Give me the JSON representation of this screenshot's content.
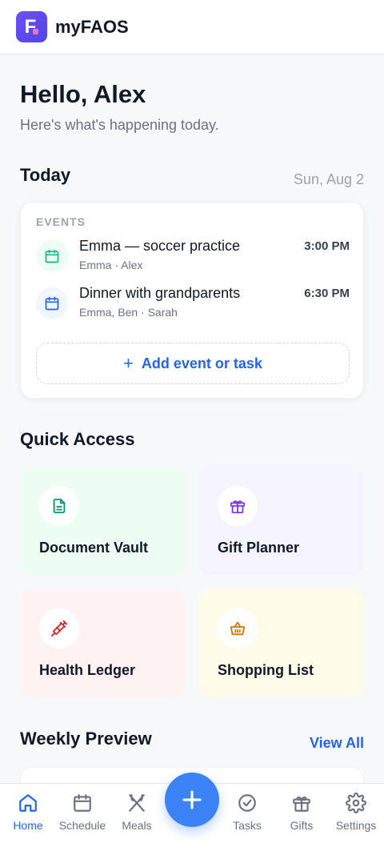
{
  "app": {
    "name": "myFAOS",
    "logo_letter": "F"
  },
  "greeting": {
    "title": "Hello, Alex",
    "subtitle": "Here's what's happening today."
  },
  "today": {
    "heading": "Today",
    "date": "Sun, Aug 2",
    "events_label": "EVENTS",
    "events": [
      {
        "title": "Emma — soccer practice",
        "people": "Emma · Alex",
        "time": "3:00 PM",
        "icon": "calendar-icon",
        "color": "#10b981"
      },
      {
        "title": "Dinner with grandparents",
        "people": "Emma, Ben · Sarah",
        "time": "6:30 PM",
        "icon": "calendar-icon",
        "color": "#2563eb"
      }
    ],
    "add_label": "Add event or task"
  },
  "quick_access": {
    "heading": "Quick Access",
    "tiles": [
      {
        "label": "Document Vault",
        "icon": "document-icon",
        "bg": "#ecfdf3",
        "color": "#059669"
      },
      {
        "label": "Gift Planner",
        "icon": "gift-icon",
        "bg": "#f5f3ff",
        "color": "#7c3aed"
      },
      {
        "label": "Health Ledger",
        "icon": "syringe-icon",
        "bg": "#fef2f2",
        "color": "#dc2626"
      },
      {
        "label": "Shopping List",
        "icon": "basket-icon",
        "bg": "#fefce8",
        "color": "#d97706"
      }
    ]
  },
  "weekly": {
    "heading": "Weekly Preview",
    "view_all": "View All"
  },
  "nav": {
    "items": [
      {
        "label": "Home",
        "icon": "home-icon",
        "active": true
      },
      {
        "label": "Schedule",
        "icon": "calendar-icon",
        "active": false
      },
      {
        "label": "Meals",
        "icon": "utensils-icon",
        "active": false
      },
      {
        "label": "Tasks",
        "icon": "check-circle-icon",
        "active": false
      },
      {
        "label": "Gifts",
        "icon": "gift-icon",
        "active": false
      },
      {
        "label": "Settings",
        "icon": "gear-icon",
        "active": false
      }
    ],
    "fab_icon": "plus-icon"
  },
  "colors": {
    "accent": "#2563eb",
    "fab": "#3b82f6"
  }
}
